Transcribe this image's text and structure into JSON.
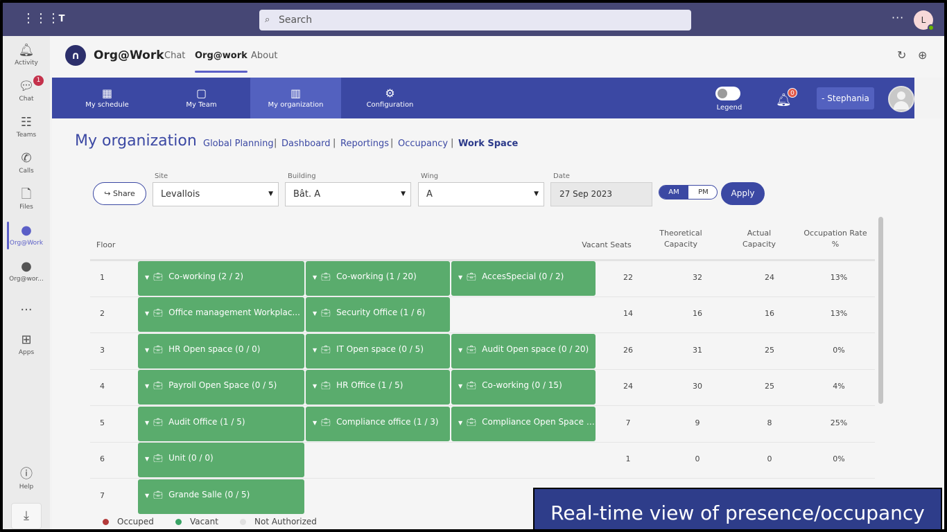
{
  "app": {
    "search_placeholder": "Search",
    "user_initial": "L",
    "app_name": "Org@Work",
    "tabs": [
      "Chat",
      "Org@work",
      "About"
    ]
  },
  "rail": {
    "items": [
      "Activity",
      "Chat",
      "Teams",
      "Calls",
      "Files",
      "Org@Work",
      "Org@wor...",
      "...",
      "Apps",
      "Help"
    ],
    "chat_badge": "1"
  },
  "nav": {
    "items": [
      "My schedule",
      "My Team",
      "My organization",
      "Configuration"
    ],
    "legend_label": "Legend",
    "notifications": "0",
    "user_button": "- Stephania"
  },
  "page": {
    "title": "My organization",
    "crumbs": [
      "Global Planning",
      "Dashboard",
      "Reportings",
      "Occupancy",
      "Work Space"
    ],
    "separator": "|"
  },
  "filters": {
    "share_label": "Share",
    "site_label": "Site",
    "site_value": "Levallois",
    "building_label": "Building",
    "building_value": "Bât. A",
    "wing_label": "Wing",
    "wing_value": "A",
    "date_label": "Date",
    "date_value": "27 Sep 2023",
    "am": "AM",
    "pm": "PM",
    "apply": "Apply"
  },
  "table": {
    "headers": {
      "floor": "Floor",
      "vacant": "Vacant Seats",
      "theoretical_1": "Theoretical",
      "theoretical_2": "Capacity",
      "actual_1": "Actual",
      "actual_2": "Capacity",
      "rate_1": "Occupation Rate",
      "rate_2": "%"
    },
    "rows": [
      {
        "floor": "1",
        "rooms": [
          "Co-working (2 / 2)",
          "Co-working (1 / 20)",
          "AccesSpecial (0 / 2)"
        ],
        "vacant": "22",
        "theoretical": "32",
        "actual": "24",
        "rate": "13%"
      },
      {
        "floor": "2",
        "rooms": [
          "Office management Workplac...",
          "Security Office (1 / 6)"
        ],
        "vacant": "14",
        "theoretical": "16",
        "actual": "16",
        "rate": "13%"
      },
      {
        "floor": "3",
        "rooms": [
          "HR Open space (0 / 0)",
          "IT Open space (0 / 5)",
          "Audit Open space (0 / 20)"
        ],
        "vacant": "26",
        "theoretical": "31",
        "actual": "25",
        "rate": "0%"
      },
      {
        "floor": "4",
        "rooms": [
          "Payroll Open Space (0 / 5)",
          "HR Office (1 / 5)",
          "Co-working (0 / 15)"
        ],
        "vacant": "24",
        "theoretical": "30",
        "actual": "25",
        "rate": "4%"
      },
      {
        "floor": "5",
        "rooms": [
          "Audit Office (1 / 5)",
          "Compliance office (1 / 3)",
          "Compliance Open Space (..."
        ],
        "vacant": "7",
        "theoretical": "9",
        "actual": "8",
        "rate": "25%"
      },
      {
        "floor": "6",
        "rooms": [
          "Unit (0 / 0)"
        ],
        "vacant": "1",
        "theoretical": "0",
        "actual": "0",
        "rate": "0%"
      },
      {
        "floor": "7",
        "rooms": [
          "Grande Salle (0 / 5)"
        ],
        "vacant": "",
        "theoretical": "",
        "actual": "",
        "rate": ""
      }
    ]
  },
  "legend": {
    "occupied": "Occuped",
    "vacant": "Vacant",
    "not_authorized": "Not Authorized",
    "colors": {
      "occupied": "#b33a3a",
      "vacant": "#3aa365",
      "not_authorized": "#e0e0e0"
    }
  },
  "caption": "Real-time view of presence/occupancy"
}
